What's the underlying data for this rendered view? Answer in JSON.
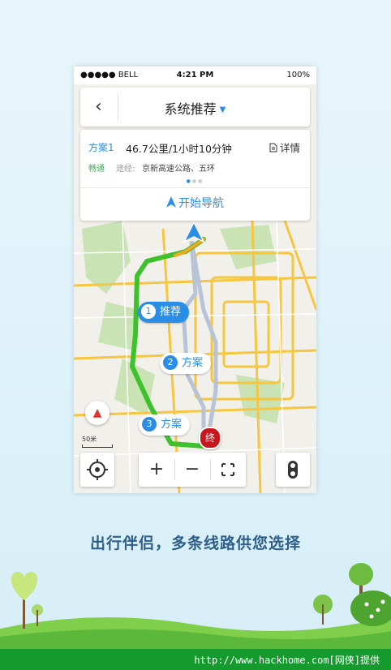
{
  "status_bar": {
    "carrier": "●●●●● BELL",
    "time": "4:21 PM",
    "battery": "100%"
  },
  "nav": {
    "back_glyph": "‹",
    "title": "系统推荐",
    "caret": "▼"
  },
  "route_card": {
    "plan_label": "方案1",
    "summary": "46.7公里/1小时10分钟",
    "detail_label": "详情",
    "traffic_status": "畅通",
    "via_label": "途经:",
    "via_roads": "京新高速公路、五环",
    "start_nav_label": "开始导航"
  },
  "map": {
    "route_labels": [
      {
        "num": "1",
        "label": "推荐"
      },
      {
        "num": "2",
        "label": "方案"
      },
      {
        "num": "3",
        "label": "方案"
      }
    ],
    "end_marker": "终",
    "scale_label": "50米",
    "colors": {
      "primary_route": "#3fc12e",
      "alt_route": "#b7c3d6",
      "highways": "#f5c640",
      "map_bg": "#f2f0ea",
      "accent": "#2b8ee6"
    }
  },
  "controls": {
    "zoom_in": "+",
    "zoom_out": "−"
  },
  "tagline": "出行伴侣，多条线路供您选择",
  "footer": {
    "text": "http://www.hackhome.com[网侠]提供"
  }
}
